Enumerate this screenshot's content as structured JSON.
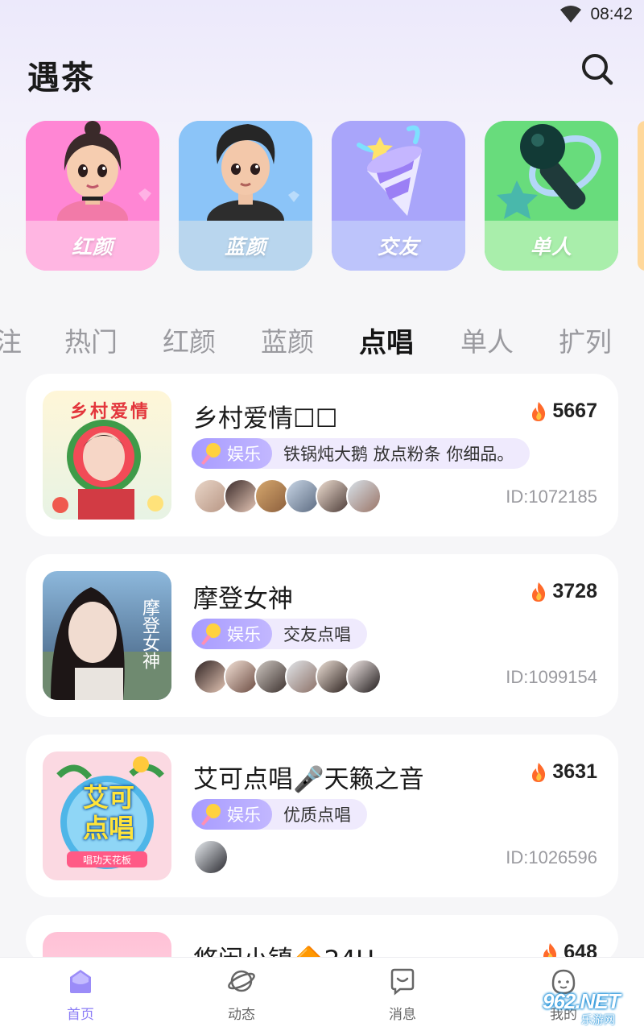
{
  "status_bar": {
    "time": "08:42"
  },
  "header": {
    "title": "遇茶",
    "search_icon": "search-icon"
  },
  "categories": [
    {
      "label": "红颜",
      "color_top": "#ff86d4",
      "color_band": "#ffb6e2"
    },
    {
      "label": "蓝颜",
      "color_top": "#8bc4f8",
      "color_band": "#b9d6ee"
    },
    {
      "label": "交友",
      "color_top": "#a9a5fa",
      "color_band": "#bdc4fb"
    },
    {
      "label": "单人",
      "color_top": "#68dc7c",
      "color_band": "#a9eeab"
    }
  ],
  "tabs": [
    {
      "label": "注",
      "active": false
    },
    {
      "label": "热门",
      "active": false
    },
    {
      "label": "红颜",
      "active": false
    },
    {
      "label": "蓝颜",
      "active": false
    },
    {
      "label": "点唱",
      "active": true
    },
    {
      "label": "单人",
      "active": false
    },
    {
      "label": "扩列",
      "active": false
    }
  ],
  "rooms": [
    {
      "title": "乡村爱情☐☐",
      "heat": "5667",
      "tag": "娱乐",
      "desc": "铁锅炖大鹅 放点粉条 你细品。",
      "id": "ID:1072185",
      "cover_text": "乡村爱情",
      "avatar_count": 6
    },
    {
      "title": "摩登女神",
      "heat": "3728",
      "tag": "娱乐",
      "desc": "交友点唱",
      "id": "ID:1099154",
      "cover_text": "摩登女神",
      "avatar_count": 6
    },
    {
      "title": "艾可点唱🎤天籁之音",
      "heat": "3631",
      "tag": "娱乐",
      "desc": "优质点唱",
      "id": "ID:1026596",
      "cover_text": "艾可点唱",
      "cover_subtext": "唱功天花板",
      "avatar_count": 1
    },
    {
      "title": "悠闲小镇🔶24H",
      "heat": "648"
    }
  ],
  "bottom_nav": [
    {
      "label": "首页",
      "icon": "home-icon",
      "active": true
    },
    {
      "label": "动态",
      "icon": "planet-icon",
      "active": false
    },
    {
      "label": "消息",
      "icon": "message-icon",
      "active": false
    },
    {
      "label": "我的",
      "icon": "profile-icon",
      "active": false
    }
  ],
  "watermark": {
    "brand": "962.NET",
    "sub": "乐游网"
  },
  "colors": {
    "accent": "#8b7cf6",
    "tag_bg": "#efeafd",
    "card_bg": "#ffffff"
  }
}
